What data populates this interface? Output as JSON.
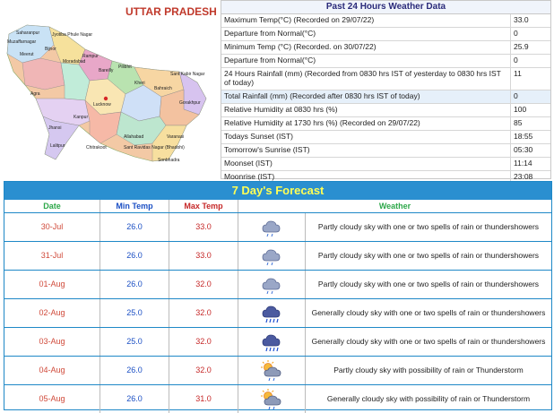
{
  "map": {
    "title": "UTTAR PRADESH",
    "labels": [
      "Saharanpur",
      "Muzaffarnagar",
      "Jyotiba Phule Nagar",
      "Meerut",
      "Bijnor",
      "Moradabad",
      "Rampur",
      "Bareilly",
      "Pilibhit",
      "Agra",
      "Kheri",
      "Bahraich",
      "Lucknow",
      "Kanpur",
      "Jhansi",
      "Lalitpur",
      "Gorakhpur",
      "Varanasi",
      "Allahabad",
      "Sant Kabir Nagar",
      "Sant Ravidas Nagar (Bhadohi)",
      "Chitrakoot",
      "Sonbhadra"
    ]
  },
  "weather": {
    "title": "Past 24 Hours Weather Data",
    "rows": [
      {
        "label": "Maximum Temp(°C) (Recorded on 29/07/22)",
        "value": "33.0"
      },
      {
        "label": "Departure from Normal(°C)",
        "value": "0"
      },
      {
        "label": "Minimum Temp (°C) (Recorded. on 30/07/22)",
        "value": "25.9"
      },
      {
        "label": "Departure from Normal(°C)",
        "value": "0"
      },
      {
        "label": "24 Hours Rainfall (mm) (Recorded from 0830 hrs IST of yesterday to 0830 hrs IST of today)",
        "value": "11"
      },
      {
        "label": "Total Rainfall (mm) (Recorded after 0830 hrs IST of today)",
        "value": "0"
      },
      {
        "label": "Relative Humidity at 0830 hrs (%)",
        "value": "100"
      },
      {
        "label": "Relative Humidity at 1730 hrs (%) (Recorded on 29/07/22)",
        "value": "85"
      },
      {
        "label": "Todays Sunset (IST)",
        "value": "18:55"
      },
      {
        "label": "Tomorrow's Sunrise (IST)",
        "value": "05:30"
      },
      {
        "label": "Moonset (IST)",
        "value": "11:14"
      },
      {
        "label": "Moonrise (IST)",
        "value": "23:08"
      }
    ]
  },
  "forecast": {
    "title": "7 Day's Forecast",
    "headers": {
      "date": "Date",
      "min": "Min Temp",
      "max": "Max Temp",
      "weather": "Weather"
    },
    "rows": [
      {
        "date": "30-Jul",
        "min": "26.0",
        "max": "33.0",
        "icon": "cloud-light-rain-icon",
        "desc": "Partly cloudy sky with one or two spells of rain or thundershowers"
      },
      {
        "date": "31-Jul",
        "min": "26.0",
        "max": "33.0",
        "icon": "cloud-light-rain-icon",
        "desc": "Partly cloudy sky with one or two spells of rain or thundershowers"
      },
      {
        "date": "01-Aug",
        "min": "26.0",
        "max": "32.0",
        "icon": "cloud-light-rain-icon",
        "desc": "Partly cloudy sky with one or two spells of rain or thundershowers"
      },
      {
        "date": "02-Aug",
        "min": "25.0",
        "max": "32.0",
        "icon": "cloud-rain-icon",
        "desc": "Generally cloudy sky with one or two spells of rain or thundershowers"
      },
      {
        "date": "03-Aug",
        "min": "25.0",
        "max": "32.0",
        "icon": "cloud-rain-icon",
        "desc": "Generally cloudy sky with one or two spells of rain or thundershowers"
      },
      {
        "date": "04-Aug",
        "min": "26.0",
        "max": "32.0",
        "icon": "sun-cloud-rain-icon",
        "desc": "Partly cloudy sky with possibility of rain or Thunderstorm"
      },
      {
        "date": "05-Aug",
        "min": "26.0",
        "max": "31.0",
        "icon": "sun-cloud-rain-icon",
        "desc": "Generally cloudy sky with possibility of rain or Thunderstorm"
      }
    ]
  }
}
